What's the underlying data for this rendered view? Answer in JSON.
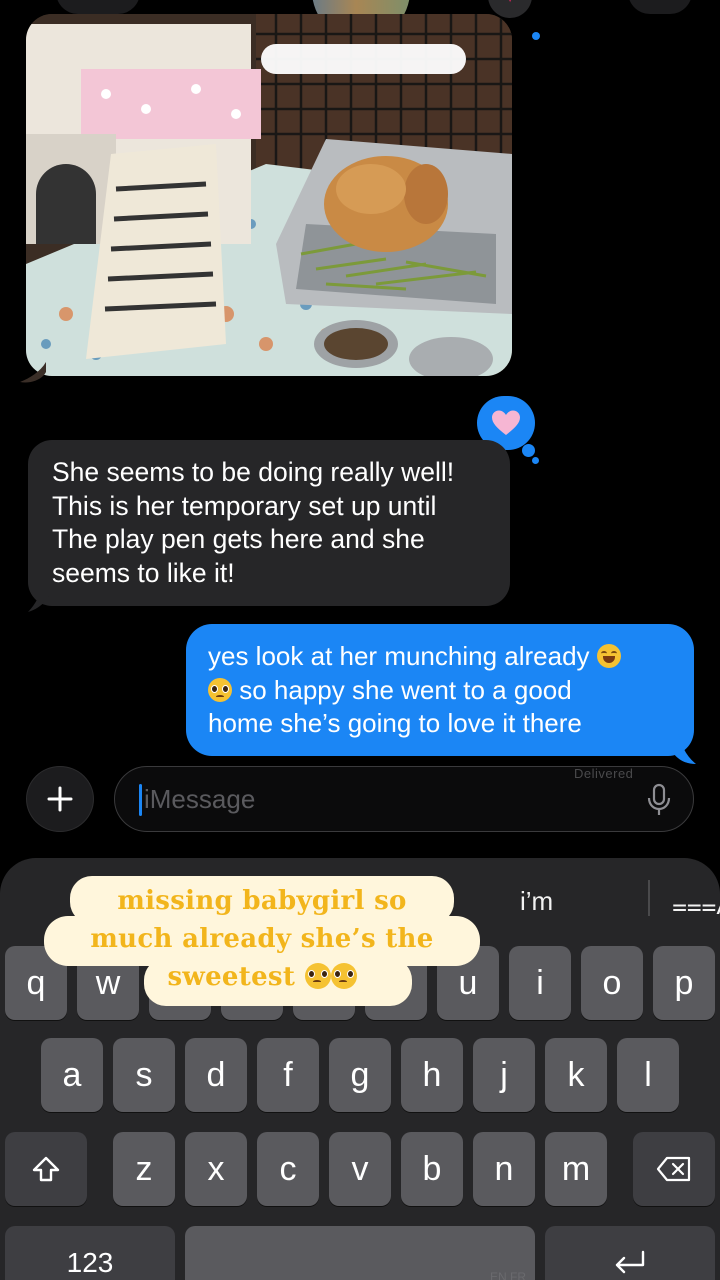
{
  "conversation": {
    "photo_alt": "bunny in temporary enclosure",
    "reaction_icon": "heart-reaction",
    "received_message": "She seems to be doing really well!\nThis is her temporary set up until\nThe play pen gets here and she\nseems to like it!",
    "sent_message": {
      "line1": "yes look at her munching already",
      "line2": "so happy she went to a good",
      "line3": "home she’s going to love it there"
    }
  },
  "composer": {
    "placeholder": "iMessage",
    "delivered_label": "Delivered"
  },
  "keyboard": {
    "suggestions": {
      "middle": "i’m",
      "right_icon": "text-format-icon"
    },
    "row1": [
      "q",
      "w",
      "e",
      "r",
      "t",
      "y",
      "u",
      "i",
      "o",
      "p"
    ],
    "row2": [
      "a",
      "s",
      "d",
      "f",
      "g",
      "h",
      "j",
      "k",
      "l"
    ],
    "row3": [
      "z",
      "x",
      "c",
      "v",
      "b",
      "n",
      "m"
    ],
    "numbers_key": "123",
    "language_label": "EN FR"
  },
  "sticker": {
    "line1": "missing babygirl so",
    "line2": "much already she’s the",
    "line3": "sweetest"
  },
  "colors": {
    "accent": "#1b86f5",
    "received_bubble": "#262628",
    "sticker_text": "#f2b51c"
  }
}
